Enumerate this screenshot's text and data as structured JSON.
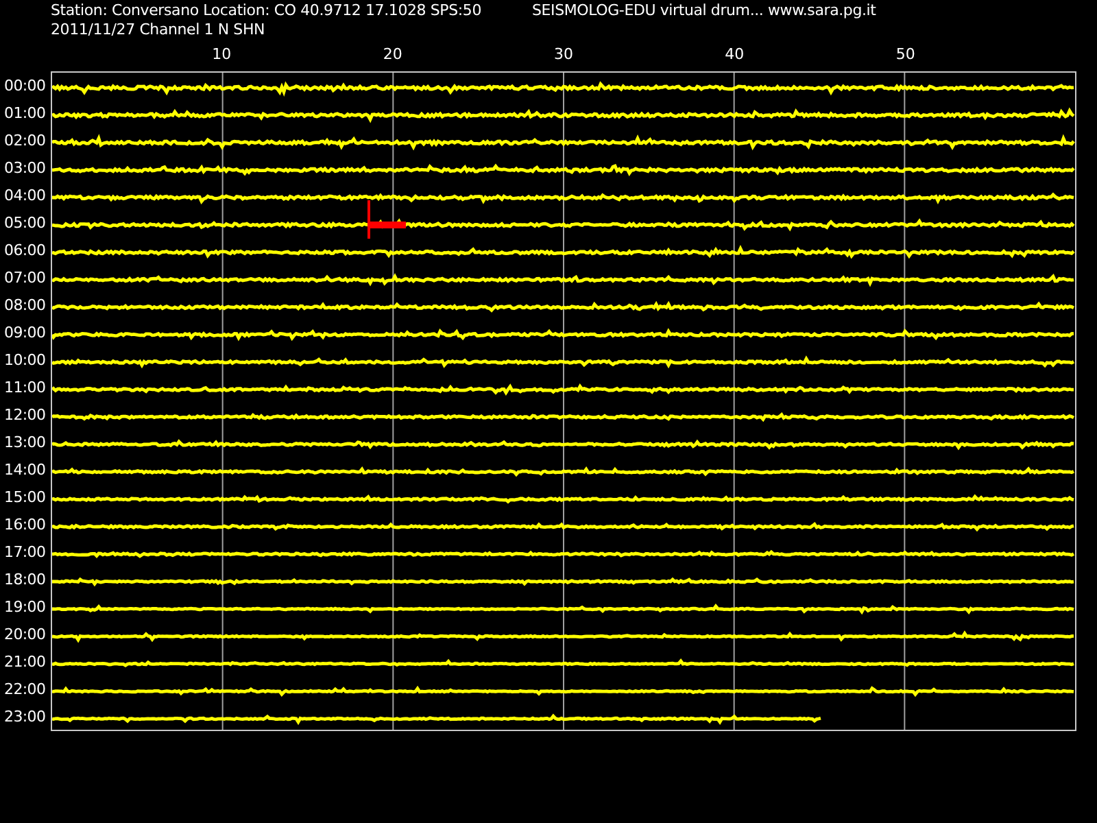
{
  "header": {
    "station_line": "Station: Conversano Location: CO 40.9712 17.1028 SPS:50",
    "title": "SEISMOLOG-EDU virtual drum... www.sara.pg.it",
    "date_line": "2011/11/27  Channel 1 N SHN"
  },
  "minute_ticks": [
    "10",
    "20",
    "30",
    "40",
    "50"
  ],
  "rows": [
    {
      "label": "00:00",
      "level": 1,
      "event": false
    },
    {
      "label": "01:00",
      "level": 1,
      "event": false
    },
    {
      "label": "02:00",
      "level": 1,
      "event": false
    },
    {
      "label": "03:00",
      "level": 1,
      "event": false
    },
    {
      "label": "04:00",
      "level": 1,
      "event": false
    },
    {
      "label": "05:00",
      "level": 1,
      "event": true
    },
    {
      "label": "06:00",
      "level": 1,
      "event": false
    },
    {
      "label": "07:00",
      "level": 1,
      "event": false
    },
    {
      "label": "08:00",
      "level": 1,
      "event": false
    },
    {
      "label": "09:00",
      "level": 1,
      "event": false
    },
    {
      "label": "10:00",
      "level": 1,
      "event": false
    },
    {
      "label": "11:00",
      "level": 1,
      "event": false
    },
    {
      "label": "12:00",
      "level": 1,
      "event": false
    },
    {
      "label": "13:00",
      "level": 1,
      "event": false
    },
    {
      "label": "14:00",
      "level": 1,
      "event": false
    },
    {
      "label": "15:00",
      "level": 1,
      "event": false
    },
    {
      "label": "16:00",
      "level": 1,
      "event": false
    },
    {
      "label": "17:00",
      "level": 1,
      "event": false
    },
    {
      "label": "18:00",
      "level": 1,
      "event": false
    },
    {
      "label": "19:00",
      "level": 1,
      "event": false
    },
    {
      "label": "20:00",
      "level": 1,
      "event": false
    },
    {
      "label": "21:00",
      "level": 1,
      "event": false
    },
    {
      "label": "22:00",
      "level": 1,
      "event": false
    },
    {
      "label": "23:00",
      "level": 0.753,
      "event": false
    }
  ]
}
